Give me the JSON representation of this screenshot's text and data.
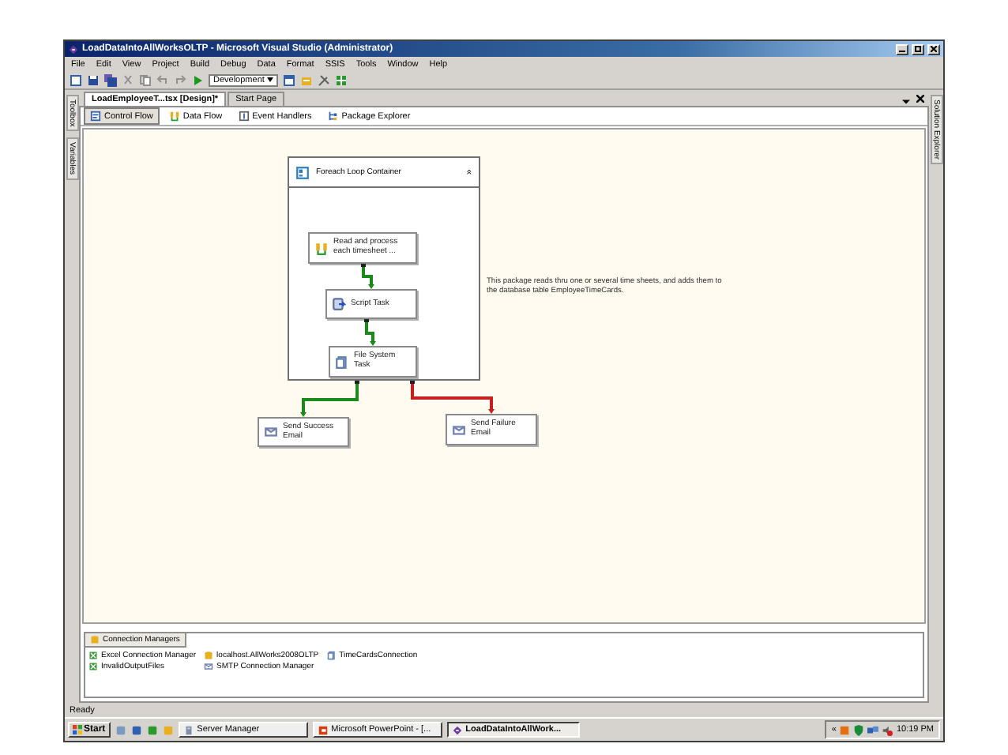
{
  "window": {
    "title": "LoadDataIntoAllWorksOLTP - Microsoft Visual Studio (Administrator)"
  },
  "menu": [
    "File",
    "Edit",
    "View",
    "Project",
    "Build",
    "Debug",
    "Data",
    "Format",
    "SSIS",
    "Tools",
    "Window",
    "Help"
  ],
  "toolbar": {
    "configuration": "Development"
  },
  "side_left": [
    "Toolbox",
    "Variables"
  ],
  "side_right": [
    "Solution Explorer"
  ],
  "doc_tabs": [
    {
      "label": "LoadEmployeeT...tsx [Design]*",
      "selected": true
    },
    {
      "label": "Start Page",
      "selected": false
    }
  ],
  "designer_tabs": [
    {
      "label": "Control Flow",
      "selected": true,
      "kind": "flow"
    },
    {
      "label": "Data Flow",
      "selected": false,
      "kind": "dataflow"
    },
    {
      "label": "Event Handlers",
      "selected": false,
      "kind": "events"
    },
    {
      "label": "Package Explorer",
      "selected": false,
      "kind": "explorer"
    }
  ],
  "diagram": {
    "nodes": [
      {
        "label": "Foreach Loop Container",
        "kind": "container",
        "collapse": "»"
      },
      {
        "label": "Read and process each timesheet ...",
        "kind": "dataflow"
      },
      {
        "label": "Script Task",
        "kind": "script"
      },
      {
        "label": "File System Task",
        "kind": "file"
      },
      {
        "label": "Send Success Email",
        "kind": "mail"
      },
      {
        "label": "Send Failure Email",
        "kind": "mail"
      }
    ],
    "connections": [
      {
        "color": "#1a8a1a"
      },
      {
        "color": "#1a8a1a"
      },
      {
        "color": "#1a8a1a"
      },
      {
        "color": "#c81e1e"
      }
    ],
    "annotation": "This package reads thru one or several time sheets, and adds them to the database table EmployeeTimeCards."
  },
  "connection_managers": {
    "title": "Connection Managers",
    "items": [
      {
        "label": "Excel Connection Manager",
        "kind": "excel"
      },
      {
        "label": "localhost.AllWorks2008OLTP",
        "kind": "db"
      },
      {
        "label": "TimeCardsConnection",
        "kind": "file"
      },
      {
        "label": "InvalidOutputFiles",
        "kind": "excel"
      },
      {
        "label": "SMTP Connection Manager",
        "kind": "mail"
      }
    ]
  },
  "status_bar": "Ready",
  "taskbar": {
    "start": "Start",
    "windows": [
      {
        "label": "Server Manager",
        "selected": false,
        "kind": "server"
      },
      {
        "label": "Microsoft PowerPoint - [...",
        "selected": false,
        "kind": "ppt"
      },
      {
        "label": "LoadDataIntoAllWork...",
        "selected": true,
        "kind": "vs"
      }
    ],
    "tray_toggle": "«",
    "clock": "10:19 PM"
  }
}
